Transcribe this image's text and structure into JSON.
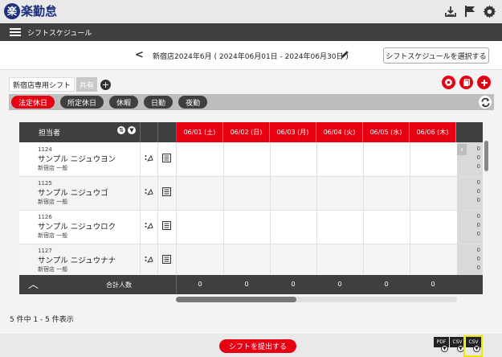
{
  "app": {
    "logo_mark": "楽",
    "logo_text": "楽勤怠",
    "menu_title": "シフトスケジュール"
  },
  "header": {
    "prev": "<",
    "period": "新宿店2024年6月 ( 2024年06月01日 - 2024年06月30日 )",
    "select_button": "シフトスケジュールを選択する"
  },
  "tabs": [
    {
      "label": "新宿店専用シフト"
    },
    {
      "label": "共有"
    }
  ],
  "filters": [
    {
      "label": "法定休日",
      "active": true
    },
    {
      "label": "所定休日",
      "active": false
    },
    {
      "label": "休暇",
      "active": false
    },
    {
      "label": "日勤",
      "active": false
    },
    {
      "label": "夜勤",
      "active": false
    }
  ],
  "table": {
    "name_header": "担当者",
    "dates": [
      "06/01 (土)",
      "06/02 (日)",
      "06/03 (月)",
      "06/04 (火)",
      "06/05 (水)",
      "06/06 (木)"
    ],
    "rows": [
      {
        "code": "1124",
        "name": "サンプル ニジュウヨン",
        "dept": "新宿店 一般"
      },
      {
        "code": "1125",
        "name": "サンプル ニジュウゴ",
        "dept": "新宿店 一般"
      },
      {
        "code": "1126",
        "name": "サンプル ニジュウロク",
        "dept": "新宿店 一般"
      },
      {
        "code": "1127",
        "name": "サンプル ニジュウナナ",
        "dept": "新宿店 一般"
      }
    ],
    "side_values": [
      "0",
      "0",
      "0"
    ],
    "total_label": "合計人数",
    "totals": [
      "0",
      "0",
      "0",
      "0",
      "0",
      "0"
    ]
  },
  "count_text": "5 件中 1 - 5 件表示",
  "footer": {
    "submit": "シフトを提出する",
    "downloads": [
      {
        "label": "PDF"
      },
      {
        "label": "CSV"
      },
      {
        "label": "CSV"
      }
    ]
  },
  "colors": {
    "accent": "#e60012",
    "dark": "#3f3f3f",
    "brand": "#1d2f7e",
    "highlight": "#f2e600"
  }
}
